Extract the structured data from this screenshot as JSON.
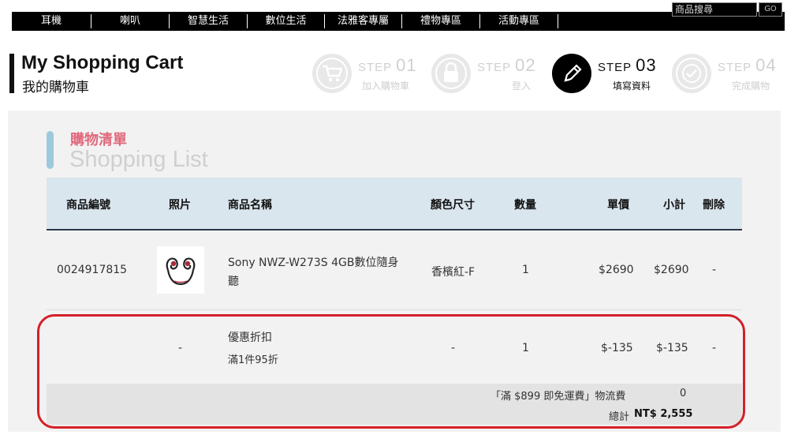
{
  "nav": {
    "items": [
      "耳機",
      "喇叭",
      "智慧生活",
      "數位生活",
      "法雅客專屬",
      "禮物專區",
      "活動專區"
    ],
    "search_placeholder": "商品搜尋",
    "search_button": "GO"
  },
  "header": {
    "title_en": "My Shopping Cart",
    "title_zh": "我的購物車"
  },
  "steps": [
    {
      "word": "STEP",
      "num": "01",
      "label": "加入購物車",
      "icon": "cart-icon",
      "active": false
    },
    {
      "word": "STEP",
      "num": "02",
      "label": "登入",
      "icon": "lock-icon",
      "active": false
    },
    {
      "word": "STEP",
      "num": "03",
      "label": "填寫資料",
      "icon": "pencil-icon",
      "active": true
    },
    {
      "word": "STEP",
      "num": "04",
      "label": "完成購物",
      "icon": "check-icon",
      "active": false
    }
  ],
  "section": {
    "title_zh": "購物清單",
    "title_en": "Shopping List"
  },
  "table": {
    "headers": [
      "商品編號",
      "照片",
      "商品名稱",
      "顏色尺寸",
      "數量",
      "單價",
      "小計",
      "刪除"
    ],
    "rows": [
      {
        "id": "0024917815",
        "photo": "earphones-thumbnail",
        "name_line1": "Sony NWZ-W273S 4GB數位隨身",
        "name_line2": "聽",
        "color_size": "香檳紅-F",
        "qty": "1",
        "price": "$2690",
        "subtotal": "$2690",
        "delete": "-"
      },
      {
        "id": "",
        "photo": "-",
        "name_line1": "優惠折扣",
        "name_line2": "滿1件95折",
        "color_size": "-",
        "qty": "1",
        "price": "$-135",
        "subtotal": "$-135",
        "delete": "-"
      }
    ]
  },
  "summary": {
    "shipping_label": "「滿 $899 即免運費」物流費",
    "shipping_value": "0",
    "total_label": "總計",
    "total_value": "NT$ 2,555"
  },
  "colors": {
    "accent_pink": "#e0697c",
    "header_blue": "#dae6ee",
    "highlight_red": "#d4202a"
  }
}
